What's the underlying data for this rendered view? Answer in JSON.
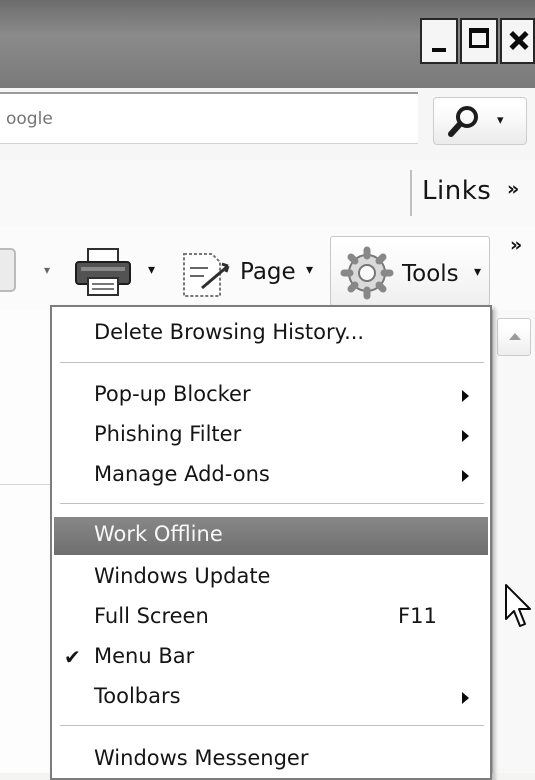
{
  "search": {
    "placeholder": "oogle"
  },
  "links_toolbar": {
    "label": "Links",
    "overflow": "»"
  },
  "command_bar": {
    "page_label": "Page",
    "tools_label": "Tools",
    "dropdown_glyph": "▾",
    "overflow": "»"
  },
  "tools_menu": {
    "items": [
      {
        "label": "Delete Browsing History..."
      },
      {
        "label": "Pop-up Blocker",
        "submenu": true
      },
      {
        "label": "Phishing Filter",
        "submenu": true
      },
      {
        "label": "Manage Add-ons",
        "submenu": true
      },
      {
        "label": "Work Offline",
        "highlighted": true
      },
      {
        "label": "Windows Update"
      },
      {
        "label": "Full Screen",
        "shortcut": "F11"
      },
      {
        "label": "Menu Bar",
        "checked": true,
        "check": "✔"
      },
      {
        "label": "Toolbars",
        "submenu": true
      },
      {
        "label": "Windows Messenger"
      }
    ]
  },
  "colors": {
    "highlight": "#7a7a7a",
    "menu_bg": "#fbfbfa",
    "titlebar": "#7e7e7e"
  },
  "icons": [
    "minimize-icon",
    "maximize-icon",
    "close-icon",
    "magnifier-icon",
    "printer-icon",
    "page-icon",
    "gear-icon",
    "mouse-cursor-icon"
  ]
}
